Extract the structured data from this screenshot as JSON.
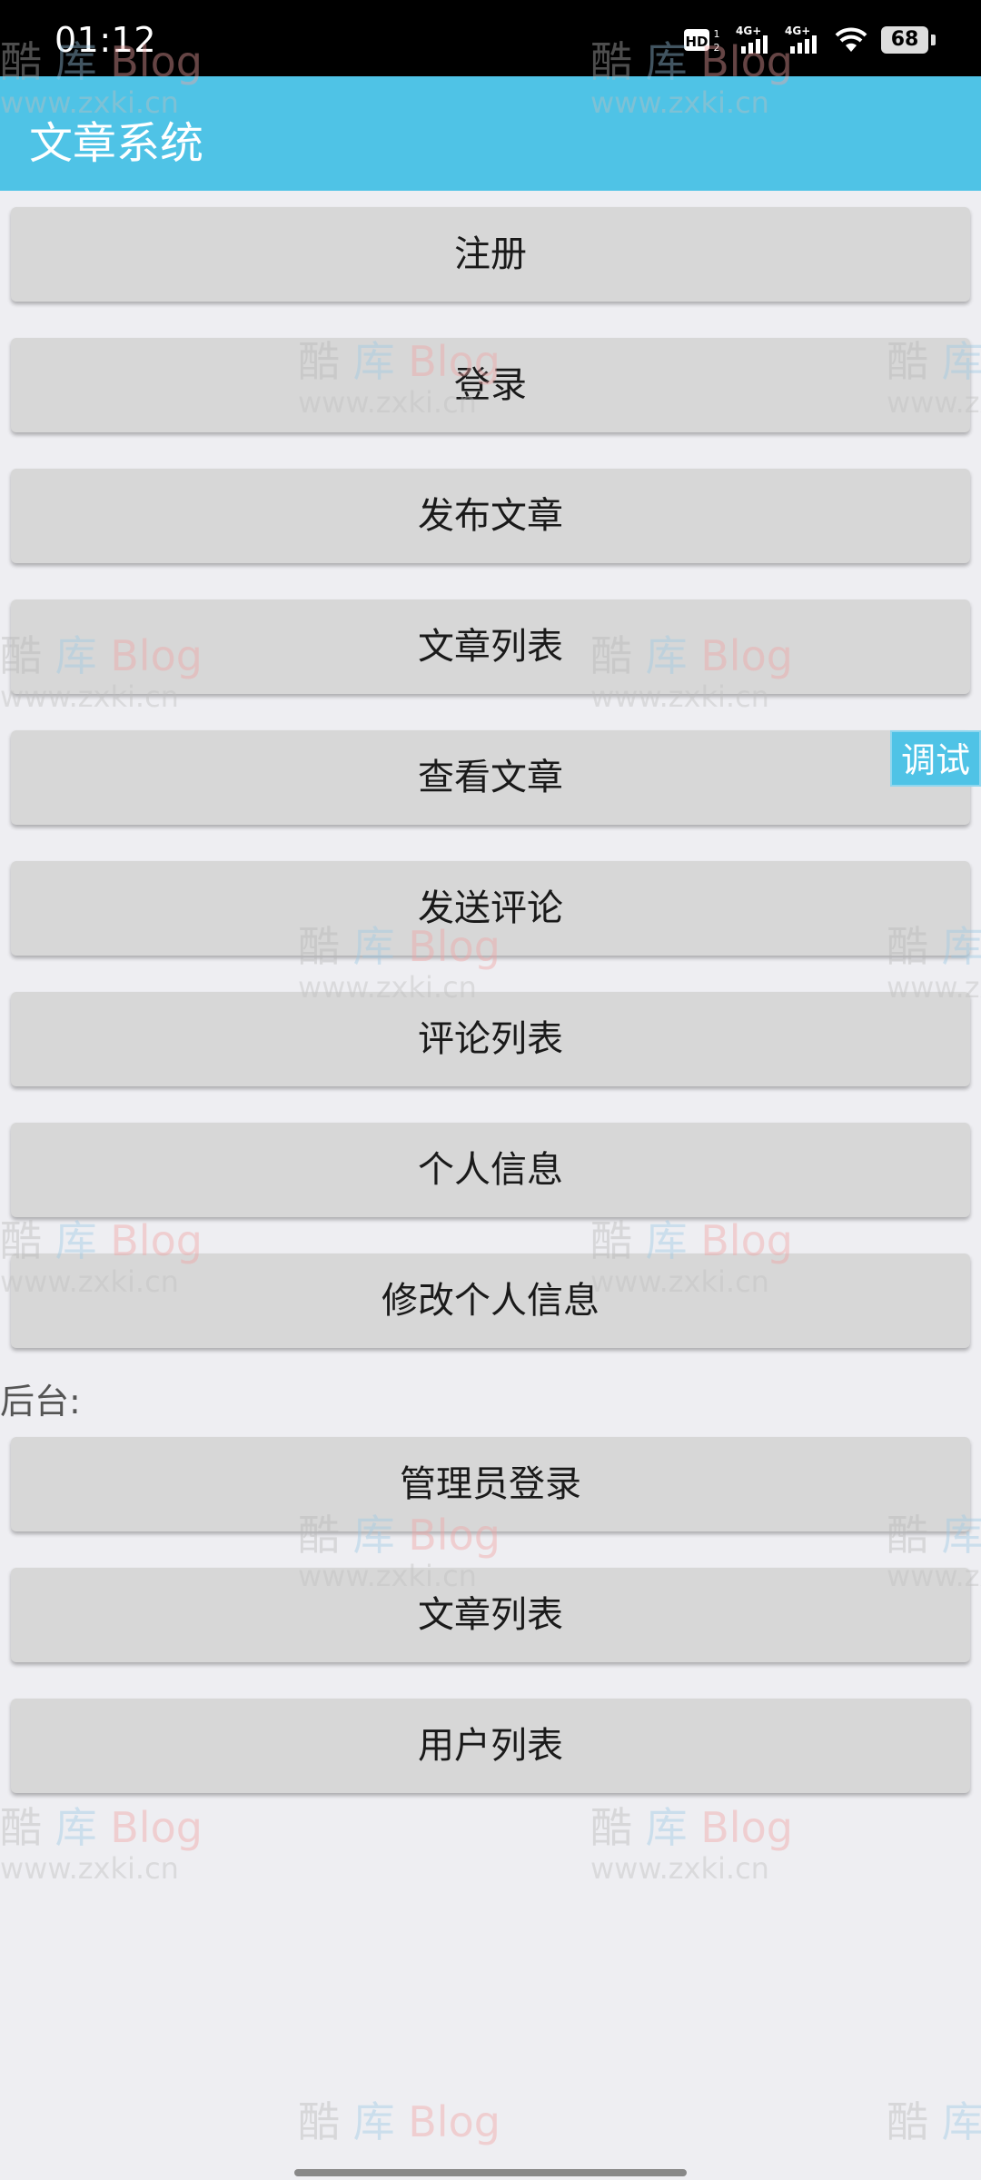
{
  "status_bar": {
    "time": "01:12",
    "signal_1": "4G+",
    "signal_2": "4G+",
    "battery": "68",
    "icons": [
      "hd-voice-icon",
      "signal-4g-icon",
      "signal-4g-icon",
      "wifi-icon",
      "battery-icon"
    ]
  },
  "app_bar": {
    "title": "文章系统"
  },
  "menu": {
    "items": [
      {
        "label": "注册"
      },
      {
        "label": "登录"
      },
      {
        "label": "发布文章"
      },
      {
        "label": "文章列表"
      },
      {
        "label": "查看文章"
      },
      {
        "label": "发送评论"
      },
      {
        "label": "评论列表"
      },
      {
        "label": "个人信息"
      },
      {
        "label": "修改个人信息"
      }
    ]
  },
  "admin": {
    "section_label": "后台:",
    "items": [
      {
        "label": "管理员登录"
      },
      {
        "label": "文章列表"
      },
      {
        "label": "用户列表"
      }
    ]
  },
  "debug_button": {
    "label": "调试"
  },
  "watermark": {
    "char1": "酷",
    "char2": "库",
    "brand": "Blog",
    "url": "www.zxki.cn"
  },
  "colors": {
    "accent": "#4fc3e6",
    "button_bg": "#d7d7d7",
    "page_bg": "#eeeef2"
  }
}
